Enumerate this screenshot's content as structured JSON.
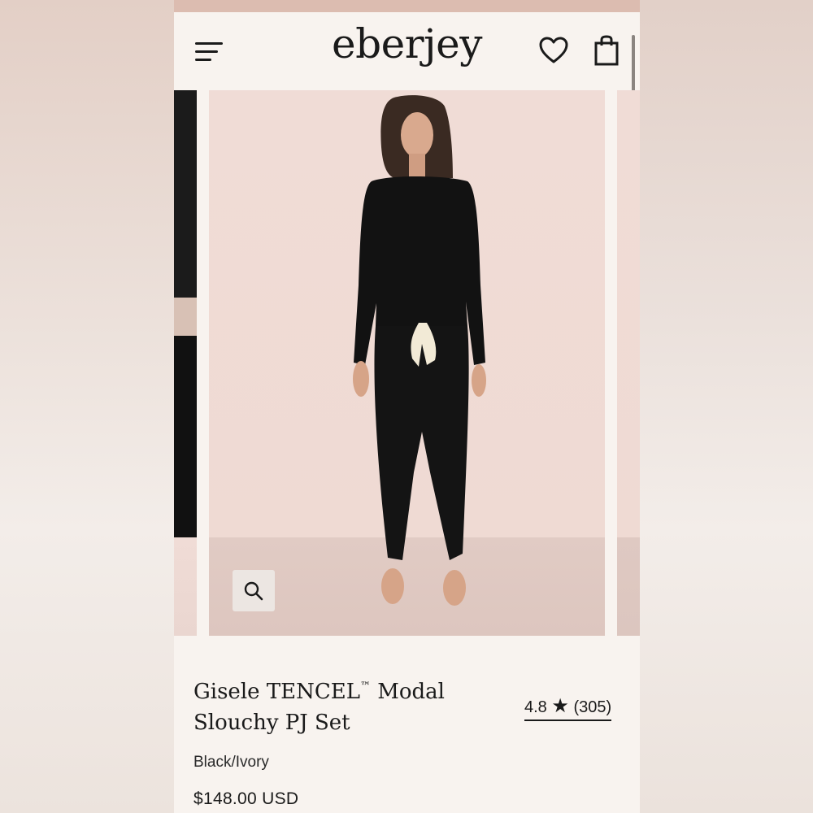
{
  "header": {
    "logo": "eberjey",
    "icons": [
      "menu-icon",
      "heart-icon",
      "shopping-bag-icon"
    ]
  },
  "gallery": {
    "zoom_icon": "magnifier-icon"
  },
  "product": {
    "title_main": "Gisele TENCEL",
    "title_tm": "™",
    "title_rest": " Modal Slouchy PJ Set",
    "rating_value": "4.8",
    "rating_star": "★",
    "rating_count": "(305)",
    "color": "Black/Ivory",
    "price": "$148.00 USD"
  },
  "colors": {
    "background": "#f8f3ef",
    "accent_strip": "#dcbcb0",
    "text": "#1a1a1a"
  }
}
